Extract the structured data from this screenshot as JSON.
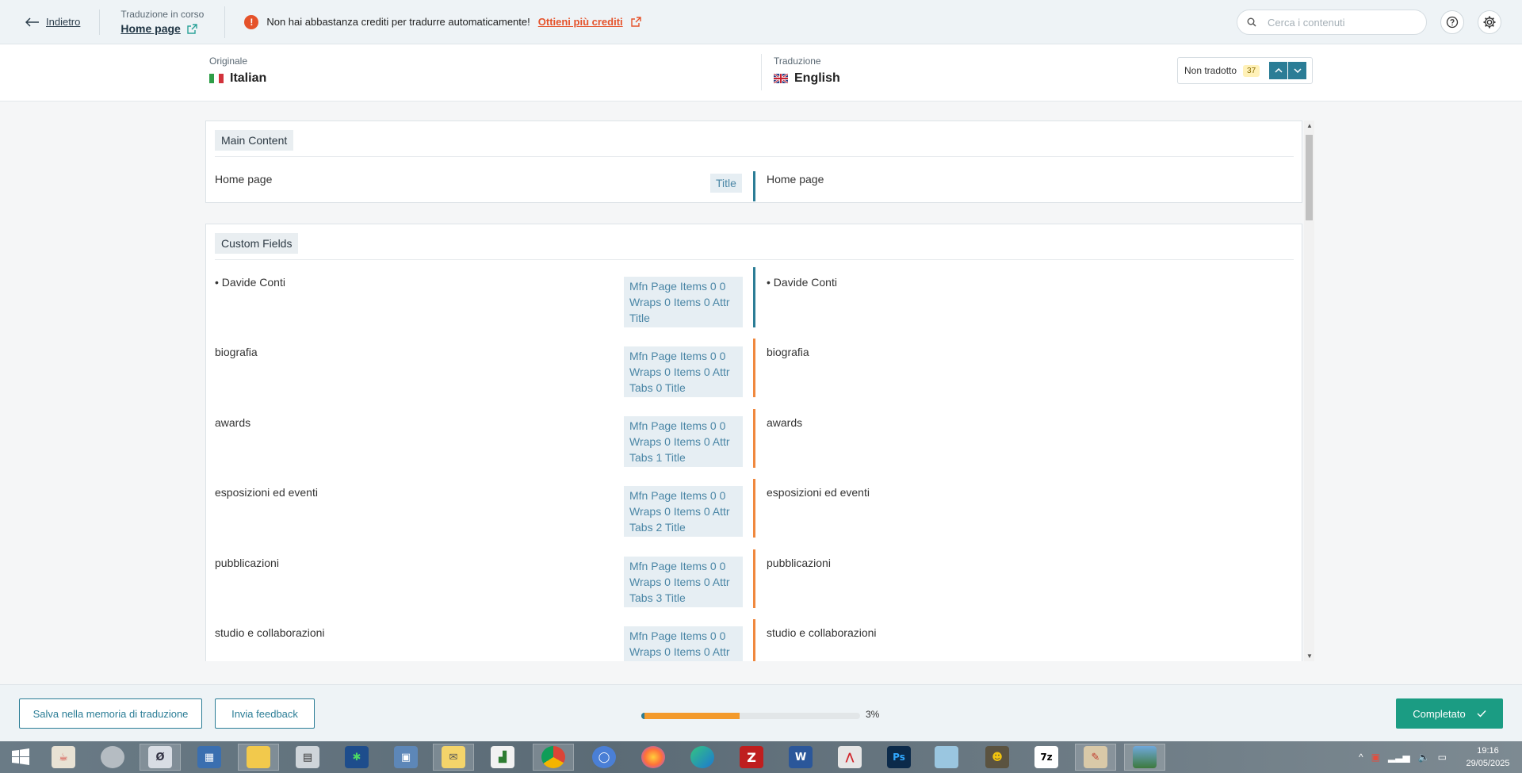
{
  "header": {
    "back_label": "Indietro",
    "breadcrumb_caption": "Traduzione in corso",
    "page_title": "Home page",
    "alert_text": "Non hai abbastanza crediti per tradurre automaticamente!",
    "alert_icon_text": "!",
    "alert_link": "Ottieni più crediti",
    "search_placeholder": "Cerca i contenuti"
  },
  "languages": {
    "original_caption": "Originale",
    "original_name": "Italian",
    "translation_caption": "Traduzione",
    "translation_name": "English",
    "filter_label": "Non tradotto",
    "filter_count": "37"
  },
  "sections": [
    {
      "title": "Main Content",
      "rows": [
        {
          "original": "Home page",
          "tag": "Title",
          "translation": "Home page",
          "status_color": "#2b7d96"
        }
      ]
    },
    {
      "title": "Custom Fields",
      "rows": [
        {
          "original": "• Davide Conti",
          "tag": "Mfn Page Items 0 0 Wraps 0 Items 0 Attr Title",
          "translation": "• Davide Conti",
          "status_color": "#2b7d96"
        },
        {
          "original": "biografia",
          "tag": "Mfn Page Items 0 0 Wraps 0 Items 0 Attr Tabs 0 Title",
          "translation": "biografia",
          "status_color": "#f0883e"
        },
        {
          "original": "awards",
          "tag": "Mfn Page Items 0 0 Wraps 0 Items 0 Attr Tabs 1 Title",
          "translation": "awards",
          "status_color": "#f0883e"
        },
        {
          "original": "esposizioni ed eventi",
          "tag": "Mfn Page Items 0 0 Wraps 0 Items 0 Attr Tabs 2 Title",
          "translation": "esposizioni ed eventi",
          "status_color": "#f0883e"
        },
        {
          "original": "pubblicazioni",
          "tag": "Mfn Page Items 0 0 Wraps 0 Items 0 Attr Tabs 3 Title",
          "translation": "pubblicazioni",
          "status_color": "#f0883e"
        },
        {
          "original": "studio e collaborazioni",
          "tag": "Mfn Page Items 0 0 Wraps 0 Items 0 Attr",
          "translation": "studio e collaborazioni",
          "status_color": "#f0883e"
        }
      ]
    }
  ],
  "footer": {
    "save_memory_label": "Salva nella memoria di traduzione",
    "feedback_label": "Invia feedback",
    "progress_percent_text": "3%",
    "progress_fraction": 0.03,
    "complete_label": "Completato"
  },
  "taskbar": {
    "apps": [
      "start-icon",
      "java-icon",
      "disc-icon",
      "app-icon",
      "control-panel-icon",
      "file-explorer-icon",
      "calculator-icon",
      "butterfly-icon",
      "computer-icon",
      "outlook-icon",
      "chart-icon",
      "chrome-icon",
      "chromium-icon",
      "firefox-icon",
      "edge-icon",
      "filezilla-icon",
      "word-icon",
      "pdf-icon",
      "photoshop-icon",
      "eraser-icon",
      "gimp-icon",
      "7zip-icon",
      "paint-icon",
      "photo-icon"
    ],
    "time": "19:16",
    "date": "29/05/2025"
  },
  "colors": {
    "accent": "#2b7d96",
    "warning": "#e5522a",
    "progress": "#f39a2c",
    "complete": "#1b9c83",
    "untranslated_bar": "#f0883e"
  }
}
